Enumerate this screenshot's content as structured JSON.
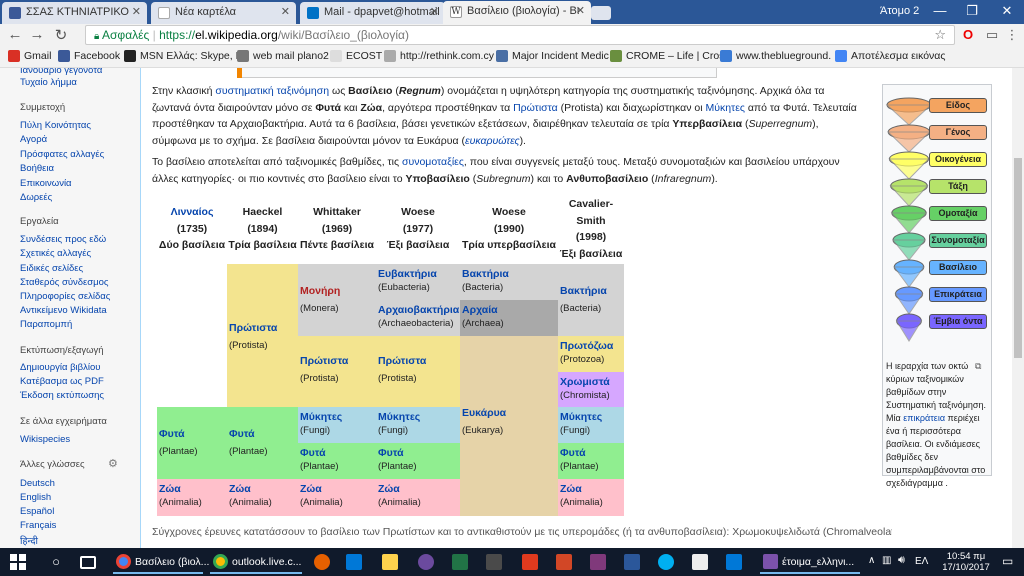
{
  "tabs": [
    {
      "title": "ΣΣΑΣ ΚΤΗΝΙΑΤΡΙΚΟ",
      "icon": "facebook-icon",
      "color": "#3b5998"
    },
    {
      "title": "Νέα καρτέλα",
      "icon": "blank-page-icon",
      "color": "#dfe4ee"
    },
    {
      "title": "Mail - dpapvet@hotmail",
      "icon": "outlook-icon",
      "color": "#0072c6"
    },
    {
      "title": "Βασίλειο (βιολογία) - Βι",
      "icon": "wikipedia-icon",
      "color": "#ffffff"
    }
  ],
  "profile_name": "Άτομο 2",
  "window_controls": {
    "minimize": "—",
    "maximize": "❐",
    "close": "✕"
  },
  "toolbar": {
    "back": "←",
    "forward": "→",
    "reload": "↻",
    "secure_label": "Ασφαλές",
    "url_scheme": "https://",
    "url_host": "el.wikipedia.org",
    "url_path": "/wiki/Βασίλειο_(βιολογία)",
    "star": "☆",
    "menu": "⋮"
  },
  "bookmarks": [
    {
      "label": "Gmail",
      "color": "#d93025"
    },
    {
      "label": "Facebook",
      "color": "#3b5998"
    },
    {
      "label": "MSN Ελλάς: Skype, H",
      "color": "#222222"
    },
    {
      "label": "web mail plano2",
      "color": "#777777"
    },
    {
      "label": "ECOST",
      "color": "#dddddd"
    },
    {
      "label": "http://rethink.com.cy",
      "color": "#aaaaaa"
    },
    {
      "label": "Major Incident Medic",
      "color": "#4a6fa5"
    },
    {
      "label": "CROME – Life | Cross",
      "color": "#6a8f3f"
    },
    {
      "label": "www.theblueground.",
      "color": "#3a7bd5"
    },
    {
      "label": "Αποτέλεσμα εικόνας",
      "color": "#4285f4"
    }
  ],
  "sidebar": {
    "top_partial": "Ιανουάριο γεγονότα",
    "random_article": "Τυχαίο λήμμα",
    "sections": [
      {
        "heading": "Συμμετοχή",
        "links": [
          "Πύλη Κοινότητας",
          "Αγορά",
          "Πρόσφατες αλλαγές",
          "Βοήθεια",
          "Επικοινωνία",
          "Δωρεές"
        ]
      },
      {
        "heading": "Εργαλεία",
        "links": [
          "Συνδέσεις προς εδώ",
          "Σχετικές αλλαγές",
          "Ειδικές σελίδες",
          "Σταθερός σύνδεσμος",
          "Πληροφορίες σελίδας",
          "Αντικείμενο Wikidata",
          "Παραπομπή"
        ]
      },
      {
        "heading": "Εκτύπωση/εξαγωγή",
        "links": [
          "Δημιουργία βιβλίου",
          "Κατέβασμα ως PDF",
          "Έκδοση εκτύπωσης"
        ]
      },
      {
        "heading": "Σε άλλα εγχειρήματα",
        "links": [
          "Wikispecies"
        ]
      },
      {
        "heading": "Άλλες γλώσσες",
        "links": [
          "Deutsch",
          "English",
          "Español",
          "Français",
          "हिन्दी"
        ]
      }
    ]
  },
  "article": {
    "p1": {
      "t1": "Στην κλασική ",
      "l1": "συστηματική ταξινόμηση",
      "t2": " ως ",
      "b1": "Βασίλειο",
      "t3": " (",
      "b2": "Regnum",
      "t4": ") ονομάζεται η υψηλότερη κατηγορία της συστηματικής ταξινόμησης. Αρχικά όλα τα ζωντανά όντα διαιρούνταν μόνο σε ",
      "b3": "Φυτά",
      "t5": " και ",
      "b4": "Ζώα",
      "t6": ", αργότερα προστέθηκαν τα ",
      "l2": "Πρώτιστα",
      "t7": " (Protista) και διαχωρίστηκαν οι ",
      "l3": "Μύκητες",
      "t8": " από τα Φυτά. Τελευταία προστέθηκαν τα Αρχαιοβακτήρια. Αυτά τα 6 βασίλεια, βάσει γενετικών εξετάσεων, διαιρέθηκαν τελευταία σε τρία ",
      "b5": "Υπερβασίλεια",
      "t9": " (",
      "i1": "Superregnum",
      "t10": "), σύμφωνα με το σχήμα. Σε βασίλεια διαιρούνται μόνον τα Ευκάρυα (",
      "i2": "ευκαρυώτες",
      "t11": ")."
    },
    "p2": {
      "t1": "Το βασίλειο αποτελείται από ταξινομικές βαθμίδες, τις ",
      "l1": "συνομοταξίες",
      "t2": ", που είναι συγγενείς μεταξύ τους. Μεταξύ συνομοταξιών και βασιλείου υπάρχουν άλλες κατηγορίες· οι πιο κοντινές στο βασίλειο είναι το ",
      "b1": "Υποβασίλειο",
      "t3": " (",
      "i1": "Subregnum",
      "t4": ") και το ",
      "b2": "Ανθυποβασίλειο",
      "t5": " (",
      "i2": "Infraregnum",
      "t6": ")."
    },
    "bottom_partial": "Σύγχρονες έρευνες κατατάσσουν το βασίλειο των Πρωτίστων και το αντικαθιστούν με τις υπερομάδες (ή τα ανθυποβασίλεια): Χρωμοκυψελιδωτά (Chromalveolata), Διαφαδόζωα"
  },
  "table": {
    "headers": [
      {
        "line1": "Λινναίος",
        "line2": "(1735)",
        "line3": "Δύο βασίλεια",
        "link": true
      },
      {
        "line1": "Haeckel",
        "line2": "(1894)",
        "line3": "Τρία βασίλεια",
        "link": false
      },
      {
        "line1": "Whittaker",
        "line2": "(1969)",
        "line3": "Πέντε βασίλεια",
        "link": false
      },
      {
        "line1": "Woese",
        "line2": "(1977)",
        "line3": "Έξι βασίλεια",
        "link": false
      },
      {
        "line1": "Woese",
        "line2": "(1990)",
        "line3": "Τρία υπερβασίλεια",
        "link": false
      },
      {
        "line1": "Cavalier-Smith",
        "line2": "(1998)",
        "line3": "Έξι βασίλεια",
        "link": false
      }
    ],
    "cells": {
      "protista_h": {
        "name": "Πρώτιστα",
        "latin": "(Protista)"
      },
      "monera": {
        "name": "Μονήρη",
        "latin": "(Monera)"
      },
      "eubacteria": {
        "name": "Ευβακτήρια",
        "latin": "(Eubacteria)"
      },
      "bacteria_w": {
        "name": "Βακτήρια",
        "latin": "(Bacteria)"
      },
      "bacteria_c": {
        "name": "Βακτήρια",
        "latin": "(Bacteria)"
      },
      "archaeo": {
        "name": "Αρχαιοβακτήρια",
        "latin": "(Archaeobacteria)"
      },
      "archaea": {
        "name": "Αρχαία",
        "latin": "(Archaea)"
      },
      "protista_w": {
        "name": "Πρώτιστα",
        "latin": "(Protista)"
      },
      "protista_w77": {
        "name": "Πρώτιστα",
        "latin": "(Protista)"
      },
      "protozoa": {
        "name": "Πρωτόζωα",
        "latin": "(Protozoa)"
      },
      "chromista": {
        "name": "Χρωμιστά",
        "latin": "(Chromista)"
      },
      "eukarya": {
        "name": "Ευκάρυα",
        "latin": "(Eukarya)"
      },
      "plants_l": {
        "name": "Φυτά",
        "latin": "(Plantae)"
      },
      "plants_h": {
        "name": "Φυτά",
        "latin": "(Plantae)"
      },
      "fungi_w": {
        "name": "Μύκητες",
        "latin": "(Fungi)"
      },
      "fungi_w77": {
        "name": "Μύκητες",
        "latin": "(Fungi)"
      },
      "fungi_c": {
        "name": "Μύκητες",
        "latin": "(Fungi)"
      },
      "plants_w": {
        "name": "Φυτά",
        "latin": "(Plantae)"
      },
      "plants_w77": {
        "name": "Φυτά",
        "latin": "(Plantae)"
      },
      "plants_c": {
        "name": "Φυτά",
        "latin": "(Plantae)"
      },
      "animals_l": {
        "name": "Ζώα",
        "latin": "(Animalia)"
      },
      "animals_h": {
        "name": "Ζώα",
        "latin": "(Animalia)"
      },
      "animals_w": {
        "name": "Ζώα",
        "latin": "(Animalia)"
      },
      "animals_w77": {
        "name": "Ζώα",
        "latin": "(Animalia)"
      },
      "animals_c": {
        "name": "Ζώα",
        "latin": "(Animalia)"
      }
    },
    "colors": {
      "yellow": "#f3e48f",
      "gray": "#d3d3d3",
      "dark_gray": "#a9a9a9",
      "blue": "#add8e6",
      "green": "#90ee90",
      "pink": "#ffc0cb",
      "purple": "#d6a7ff",
      "tan": "#e6d3a8",
      "monera_text": "#b22222"
    }
  },
  "infobox": {
    "ranks": [
      {
        "label": "Είδος",
        "color": "#f4a460"
      },
      {
        "label": "Γένος",
        "color": "#f4b084"
      },
      {
        "label": "Οικογένεια",
        "color": "#ffff66"
      },
      {
        "label": "Τάξη",
        "color": "#b6e36a"
      },
      {
        "label": "Ομοταξία",
        "color": "#66d066"
      },
      {
        "label": "Συνομοταξία",
        "color": "#66d09e"
      },
      {
        "label": "Βασίλειο",
        "color": "#66b3ff"
      },
      {
        "label": "Επικράτεια",
        "color": "#6699ff"
      },
      {
        "label": "Έμβια όντα",
        "color": "#7a66ff"
      }
    ],
    "caption_t1": "Η ιεραρχία των οκτώ κύριων ταξινομικών βαθμίδων στην Συστηματική ταξινόμηση. Μία ",
    "caption_link": "επικράτεια",
    "caption_t2": " περιέχει ένα ή περισσότερα βασίλεια. Οι ενδιάμεσες βαθμίδες δεν συμπεριλαμβάνονται στο σχεδιάγραμμα ."
  },
  "taskbar": {
    "apps": [
      {
        "label": "Βασίλειο (βιολ...",
        "color": "#4285f4"
      },
      {
        "label": "outlook.live.c...",
        "color": "#fbbc05"
      },
      {
        "label": "έτοιμα_ελληνι...",
        "color": "#7b52ab"
      }
    ],
    "icons": [
      "#1e90ff",
      "#ffffff",
      "#ffd24d",
      "#0078d7",
      "#6b4a9e",
      "#217346",
      "#e03a1e",
      "#d24726",
      "#80397b",
      "#2b579a",
      "#00aff0",
      "#ffffff",
      "#0078d7",
      "#cccccc"
    ],
    "lang": "ΕΛ",
    "time": "10:54 πμ",
    "date": "17/10/2017"
  }
}
